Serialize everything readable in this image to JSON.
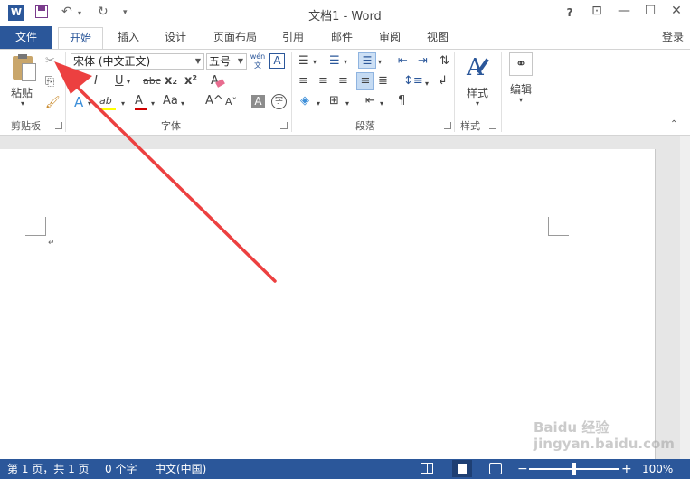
{
  "titlebar": {
    "title": "文档1 - Word",
    "help": "?",
    "ribbon_display": "⊡",
    "minimize": "—",
    "maximize": "☐",
    "close": "✕",
    "word_icon": "W"
  },
  "tabs": {
    "file": "文件",
    "items": [
      "开始",
      "插入",
      "设计",
      "页面布局",
      "引用",
      "邮件",
      "审阅",
      "视图"
    ],
    "login": "登录"
  },
  "clipboard": {
    "paste": "粘贴",
    "group_label": "剪贴板"
  },
  "font": {
    "font_name": "宋体 (中文正文)",
    "font_size": "五号",
    "wen_glyph": "wén文",
    "border_glyph": "A",
    "bold": "B",
    "italic": "I",
    "underline": "U",
    "strike": "abc",
    "sub": "x₂",
    "sup": "x²",
    "clear": "A",
    "effects": "A",
    "highlight": "ab",
    "color": "A",
    "case": "Aa",
    "grow": "A^",
    "shrink": "Aˇ",
    "shade": "A",
    "circle": "字",
    "group_label": "字体"
  },
  "paragraph": {
    "group_label": "段落"
  },
  "styles": {
    "label": "样式",
    "group_label": "样式"
  },
  "editing": {
    "label": "编辑"
  },
  "document": {
    "paragraph_mark": "↵"
  },
  "status": {
    "page": "第 1 页，共 1 页",
    "words": "0 个字",
    "language": "中文(中国)",
    "zoom": "100%",
    "zoom_level": 0.5
  },
  "colors": {
    "accent": "#2b579a",
    "arrow": "#ec4040",
    "font_color_bar": "#d00000",
    "highlight_bar": "#ffff00"
  },
  "watermark": "Baidu 经验 jingyan.baidu.com"
}
